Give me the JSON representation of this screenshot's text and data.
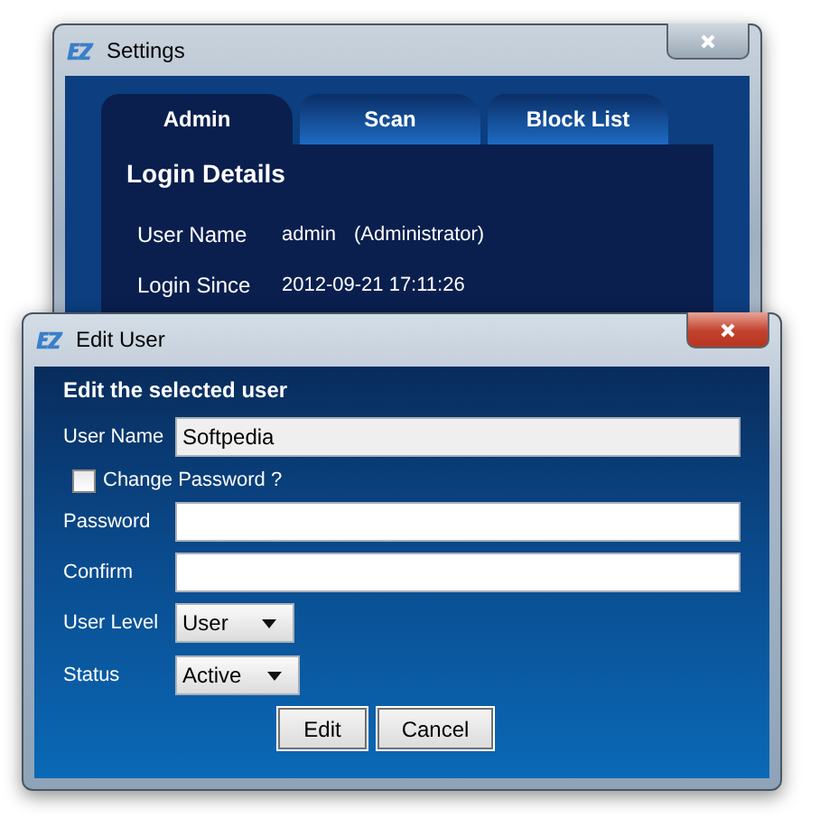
{
  "settings_window": {
    "title": "Settings",
    "tabs": [
      {
        "label": "Admin",
        "selected": true
      },
      {
        "label": "Scan",
        "selected": false
      },
      {
        "label": "Block List",
        "selected": false
      }
    ],
    "panel": {
      "heading": "Login Details",
      "rows": [
        {
          "label": "User Name",
          "value": "admin",
          "note": "(Administrator)"
        },
        {
          "label": "Login Since",
          "value": "2012-09-21 17:11:26"
        }
      ]
    }
  },
  "edit_user_window": {
    "title": "Edit User",
    "heading": "Edit the selected user",
    "fields": [
      {
        "kind": "text",
        "label": "User Name",
        "value": "Softpedia",
        "disabled": true
      },
      {
        "kind": "checkbox",
        "label": "Change Password ?",
        "checked": false
      },
      {
        "kind": "text",
        "label": "Password",
        "disabled": false
      },
      {
        "kind": "text",
        "label": "Confirm",
        "disabled": false
      },
      {
        "kind": "select",
        "label": "User Level",
        "value": "User"
      },
      {
        "kind": "select",
        "label": "Status",
        "value": "Active"
      }
    ],
    "buttons": [
      "Edit",
      "Cancel"
    ]
  }
}
